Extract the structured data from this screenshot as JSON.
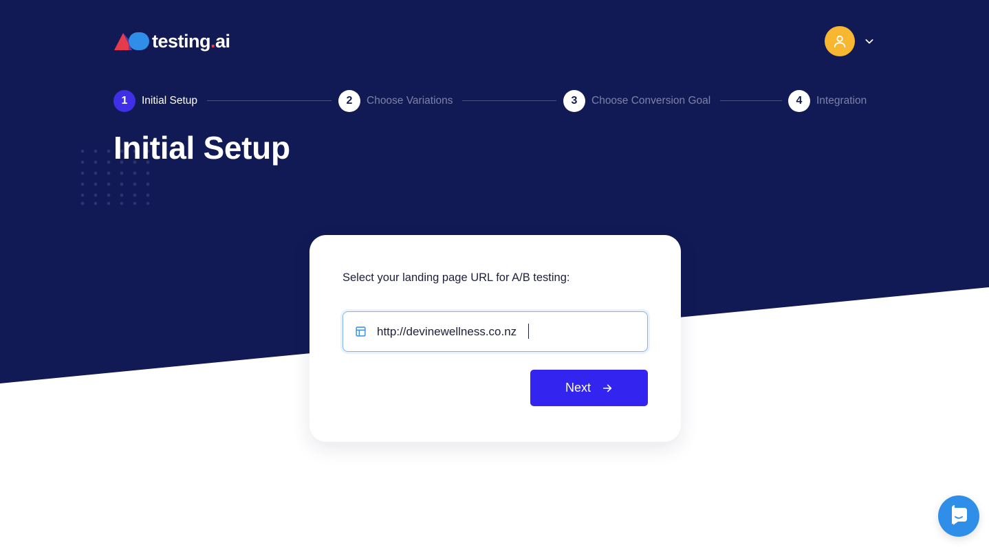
{
  "brand": {
    "logo_text": "testing",
    "logo_suffix_dot": ".",
    "logo_suffix": "ai"
  },
  "user_menu": {
    "avatar_icon": "user-icon",
    "dropdown_icon": "chevron-down-icon"
  },
  "stepper": {
    "steps": [
      {
        "number": "1",
        "label": "Initial Setup",
        "active": true
      },
      {
        "number": "2",
        "label": "Choose Variations",
        "active": false
      },
      {
        "number": "3",
        "label": "Choose Conversion Goal",
        "active": false
      },
      {
        "number": "4",
        "label": "Integration",
        "active": false
      }
    ]
  },
  "page": {
    "title": "Initial Setup"
  },
  "form": {
    "prompt": "Select your landing page URL for A/B testing:",
    "url_value": "http://devinewellness.co.nz",
    "url_icon": "layout-icon",
    "next_label": "Next",
    "next_icon": "arrow-right-icon"
  },
  "chat": {
    "icon": "chat-bubble-icon"
  },
  "colors": {
    "hero_bg": "#121a55",
    "accent": "#3324ef",
    "avatar": "#f7b731",
    "logo_red": "#e53b4a",
    "logo_blue": "#2f8ee8",
    "chat": "#2f8ee8"
  }
}
